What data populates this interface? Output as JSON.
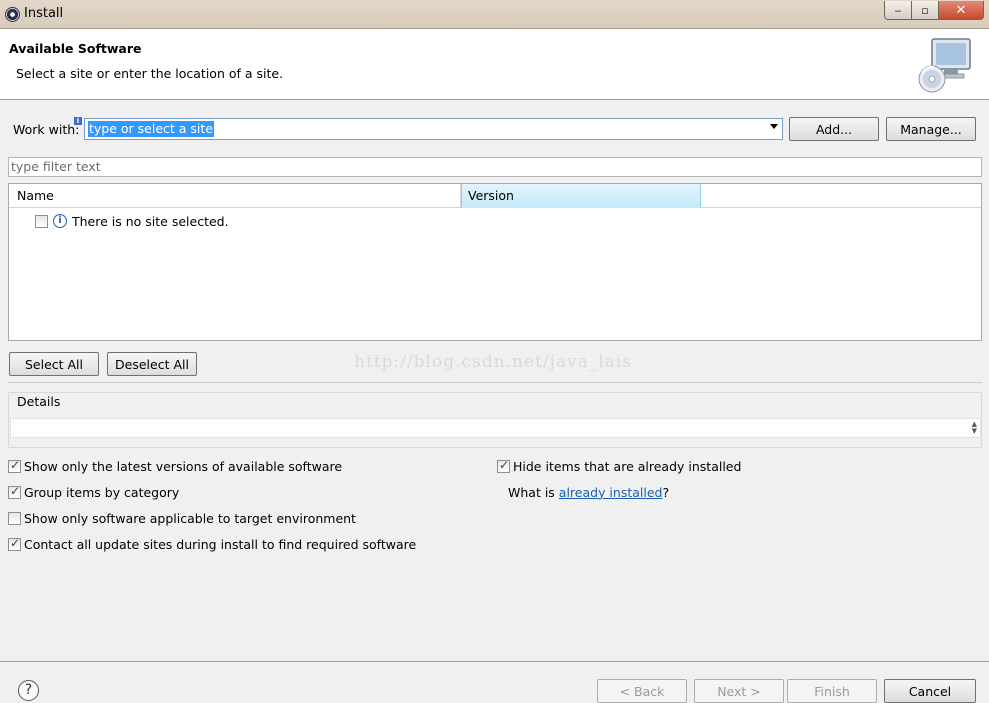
{
  "window": {
    "title": "Install",
    "minimize_glyph": "‒",
    "maximize_glyph": "▫",
    "close_glyph": "✕"
  },
  "header": {
    "title": "Available Software",
    "description": "Select a site or enter the location of a site."
  },
  "work_with": {
    "label": "Work with:",
    "info_glyph": "i",
    "value": "type or select a site",
    "add_label": "Add...",
    "manage_label": "Manage..."
  },
  "filter": {
    "placeholder": "type filter text"
  },
  "table": {
    "columns": [
      "Name",
      "Version"
    ],
    "rows": [
      {
        "checked": false,
        "icon": "info-icon",
        "text": "There is no site selected."
      }
    ]
  },
  "selection": {
    "select_all_label": "Select All",
    "deselect_all_label": "Deselect All"
  },
  "watermark": "http://blog.csdn.net/java_lais",
  "details": {
    "label": "Details",
    "spin_up": "▲",
    "spin_down": "▼"
  },
  "options": {
    "latest_versions": {
      "label": "Show only the latest versions of available software",
      "checked": true
    },
    "group_by_category": {
      "label": "Group items by category",
      "checked": true
    },
    "applicable_target": {
      "label": "Show only software applicable to target environment",
      "checked": false
    },
    "contact_sites": {
      "label": "Contact all update sites during install to find required software",
      "checked": true
    },
    "hide_installed": {
      "label": "Hide items that are already installed",
      "checked": true
    },
    "what_is_prefix": "What is ",
    "already_installed_link": "already installed",
    "what_is_suffix": "?"
  },
  "footer": {
    "help_glyph": "?",
    "back_label": "< Back",
    "next_label": "Next >",
    "finish_label": "Finish",
    "cancel_label": "Cancel"
  },
  "colors": {
    "selection_highlight": "#3399ff",
    "link": "#1a5fb4",
    "version_header": "#c4e9f8"
  }
}
